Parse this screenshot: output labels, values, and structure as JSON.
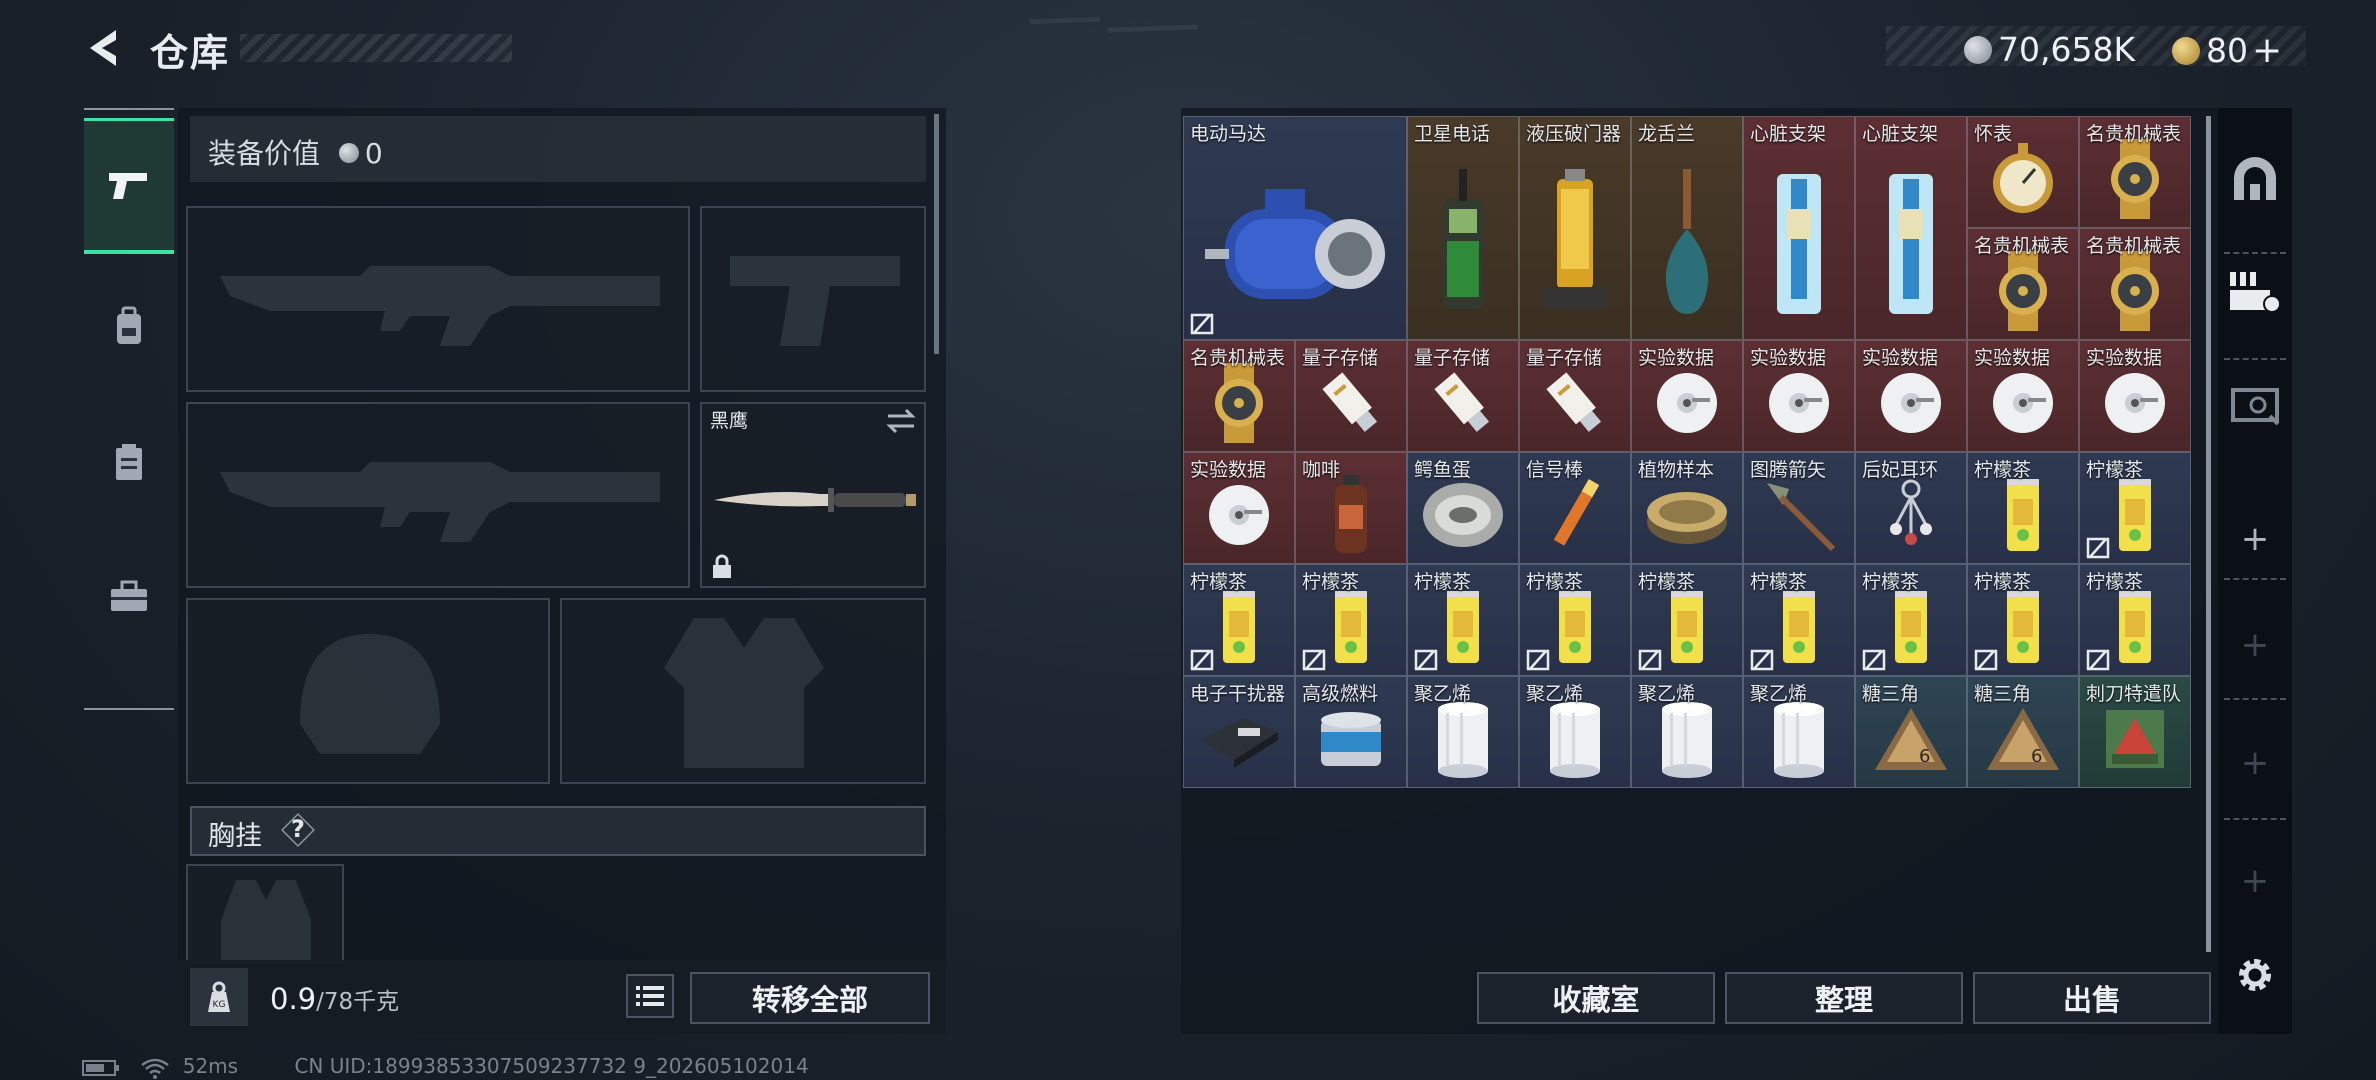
{
  "header": {
    "title": "仓库",
    "currency": [
      {
        "icon": "silver-coin-icon",
        "value": "70,658K"
      },
      {
        "icon": "gold-coin-icon",
        "value": "80"
      }
    ],
    "add_label": "+"
  },
  "left_nav": [
    {
      "icon": "pistol-icon",
      "active": true
    },
    {
      "icon": "backpack-icon",
      "active": false
    },
    {
      "icon": "clipboard-icon",
      "active": false
    },
    {
      "icon": "toolbox-icon",
      "active": false
    }
  ],
  "equipment": {
    "value_label": "装备价值",
    "value": "0",
    "melee_name": "黑鹰",
    "chest_label": "胸挂",
    "chest_help": "?",
    "weight_current": "0.9",
    "weight_max": "/78千克",
    "transfer_all": "转移全部"
  },
  "stash": {
    "items": [
      {
        "name": "电动马达",
        "icon": "motor-icon",
        "color": "blue",
        "col": 0,
        "row": 0,
        "w": 2,
        "h": 2,
        "nolock": true
      },
      {
        "name": "卫星电话",
        "icon": "sat-phone-icon",
        "color": "gold",
        "col": 2,
        "row": 0,
        "w": 1,
        "h": 2
      },
      {
        "name": "液压破门器",
        "icon": "hydraulic-breacher-icon",
        "color": "gold",
        "col": 3,
        "row": 0,
        "w": 1,
        "h": 2
      },
      {
        "name": "龙舌兰",
        "icon": "tequila-bottle-icon",
        "color": "gold",
        "col": 4,
        "row": 0,
        "w": 1,
        "h": 2
      },
      {
        "name": "心脏支架",
        "icon": "heart-stent-icon",
        "color": "red",
        "col": 5,
        "row": 0,
        "w": 1,
        "h": 2
      },
      {
        "name": "心脏支架",
        "icon": "heart-stent-icon",
        "color": "red",
        "col": 6,
        "row": 0,
        "w": 1,
        "h": 2
      },
      {
        "name": "怀表",
        "icon": "pocket-watch-icon",
        "color": "red",
        "col": 7,
        "row": 0,
        "w": 1,
        "h": 1
      },
      {
        "name": "名贵机械表",
        "icon": "gold-watch-icon",
        "color": "red",
        "col": 8,
        "row": 0,
        "w": 1,
        "h": 1
      },
      {
        "name": "名贵机械表",
        "icon": "gold-watch-icon",
        "color": "red",
        "col": 7,
        "row": 1,
        "w": 1,
        "h": 1
      },
      {
        "name": "名贵机械表",
        "icon": "gold-watch-icon",
        "color": "red",
        "col": 8,
        "row": 1,
        "w": 1,
        "h": 1
      },
      {
        "name": "名贵机械表",
        "icon": "gold-watch-icon",
        "color": "red",
        "col": 0,
        "row": 2,
        "w": 1,
        "h": 1
      },
      {
        "name": "量子存储",
        "icon": "usb-drive-icon",
        "color": "red",
        "col": 1,
        "row": 2,
        "w": 1,
        "h": 1
      },
      {
        "name": "量子存储",
        "icon": "usb-drive-icon",
        "color": "red",
        "col": 2,
        "row": 2,
        "w": 1,
        "h": 1
      },
      {
        "name": "量子存储",
        "icon": "usb-drive-icon",
        "color": "red",
        "col": 3,
        "row": 2,
        "w": 1,
        "h": 1
      },
      {
        "name": "实验数据",
        "icon": "data-disc-icon",
        "color": "red",
        "col": 4,
        "row": 2,
        "w": 1,
        "h": 1
      },
      {
        "name": "实验数据",
        "icon": "data-disc-icon",
        "color": "red",
        "col": 5,
        "row": 2,
        "w": 1,
        "h": 1
      },
      {
        "name": "实验数据",
        "icon": "data-disc-icon",
        "color": "red",
        "col": 6,
        "row": 2,
        "w": 1,
        "h": 1
      },
      {
        "name": "实验数据",
        "icon": "data-disc-icon",
        "color": "red",
        "col": 7,
        "row": 2,
        "w": 1,
        "h": 1
      },
      {
        "name": "实验数据",
        "icon": "data-disc-icon",
        "color": "red",
        "col": 8,
        "row": 2,
        "w": 1,
        "h": 1
      },
      {
        "name": "实验数据",
        "icon": "data-disc-icon",
        "color": "red",
        "col": 0,
        "row": 3,
        "w": 1,
        "h": 1
      },
      {
        "name": "咖啡",
        "icon": "coffee-bottle-icon",
        "color": "red",
        "col": 1,
        "row": 3,
        "w": 1,
        "h": 1
      },
      {
        "name": "鳄鱼蛋",
        "icon": "croc-egg-icon",
        "color": "blue",
        "col": 2,
        "row": 3,
        "w": 1,
        "h": 1
      },
      {
        "name": "信号棒",
        "icon": "flare-stick-icon",
        "color": "blue",
        "col": 3,
        "row": 3,
        "w": 1,
        "h": 1
      },
      {
        "name": "植物样本",
        "icon": "plant-sample-icon",
        "color": "blue",
        "col": 4,
        "row": 3,
        "w": 1,
        "h": 1
      },
      {
        "name": "图腾箭矢",
        "icon": "totem-arrow-icon",
        "color": "blue",
        "col": 5,
        "row": 3,
        "w": 1,
        "h": 1
      },
      {
        "name": "后妃耳环",
        "icon": "earring-icon",
        "color": "blue",
        "col": 6,
        "row": 3,
        "w": 1,
        "h": 1
      },
      {
        "name": "柠檬茶",
        "icon": "lemon-tea-can-icon",
        "color": "blue",
        "col": 7,
        "row": 3,
        "w": 1,
        "h": 1
      },
      {
        "name": "柠檬茶",
        "icon": "lemon-tea-can-icon",
        "color": "blue",
        "col": 8,
        "row": 3,
        "w": 1,
        "h": 1,
        "nolock": true
      },
      {
        "name": "柠檬茶",
        "icon": "lemon-tea-can-icon",
        "color": "blue",
        "col": 0,
        "row": 4,
        "w": 1,
        "h": 1,
        "nolock": true
      },
      {
        "name": "柠檬茶",
        "icon": "lemon-tea-can-icon",
        "color": "blue",
        "col": 1,
        "row": 4,
        "w": 1,
        "h": 1,
        "nolock": true
      },
      {
        "name": "柠檬茶",
        "icon": "lemon-tea-can-icon",
        "color": "blue",
        "col": 2,
        "row": 4,
        "w": 1,
        "h": 1,
        "nolock": true
      },
      {
        "name": "柠檬茶",
        "icon": "lemon-tea-can-icon",
        "color": "blue",
        "col": 3,
        "row": 4,
        "w": 1,
        "h": 1,
        "nolock": true
      },
      {
        "name": "柠檬茶",
        "icon": "lemon-tea-can-icon",
        "color": "blue",
        "col": 4,
        "row": 4,
        "w": 1,
        "h": 1,
        "nolock": true
      },
      {
        "name": "柠檬茶",
        "icon": "lemon-tea-can-icon",
        "color": "blue",
        "col": 5,
        "row": 4,
        "w": 1,
        "h": 1,
        "nolock": true
      },
      {
        "name": "柠檬茶",
        "icon": "lemon-tea-can-icon",
        "color": "blue",
        "col": 6,
        "row": 4,
        "w": 1,
        "h": 1,
        "nolock": true
      },
      {
        "name": "柠檬茶",
        "icon": "lemon-tea-can-icon",
        "color": "blue",
        "col": 7,
        "row": 4,
        "w": 1,
        "h": 1,
        "nolock": true
      },
      {
        "name": "柠檬茶",
        "icon": "lemon-tea-can-icon",
        "color": "blue",
        "col": 8,
        "row": 4,
        "w": 1,
        "h": 1,
        "nolock": true
      },
      {
        "name": "电子干扰器",
        "icon": "jammer-icon",
        "color": "blue",
        "col": 0,
        "row": 5,
        "w": 1,
        "h": 1
      },
      {
        "name": "高级燃料",
        "icon": "fuel-can-icon",
        "color": "blue",
        "col": 1,
        "row": 5,
        "w": 1,
        "h": 1
      },
      {
        "name": "聚乙烯",
        "icon": "polyethylene-roll-icon",
        "color": "blue",
        "col": 2,
        "row": 5,
        "w": 1,
        "h": 1
      },
      {
        "name": "聚乙烯",
        "icon": "polyethylene-roll-icon",
        "color": "blue",
        "col": 3,
        "row": 5,
        "w": 1,
        "h": 1
      },
      {
        "name": "聚乙烯",
        "icon": "polyethylene-roll-icon",
        "color": "blue",
        "col": 4,
        "row": 5,
        "w": 1,
        "h": 1
      },
      {
        "name": "聚乙烯",
        "icon": "polyethylene-roll-icon",
        "color": "blue",
        "col": 5,
        "row": 5,
        "w": 1,
        "h": 1
      },
      {
        "name": "糖三角",
        "icon": "sugar-triangle-icon",
        "color": "teal",
        "col": 6,
        "row": 5,
        "w": 1,
        "h": 1
      },
      {
        "name": "糖三角",
        "icon": "sugar-triangle-icon",
        "color": "teal",
        "col": 7,
        "row": 5,
        "w": 1,
        "h": 1
      },
      {
        "name": "刺刀特遣队",
        "icon": "bayonet-squad-card-icon",
        "color": "green",
        "col": 8,
        "row": 5,
        "w": 1,
        "h": 1
      }
    ],
    "buttons": {
      "collection": "收藏室",
      "sort": "整理",
      "sell": "出售"
    }
  },
  "right_nav": [
    {
      "icon": "safe-house-icon"
    },
    {
      "icon": "equipment-sort-icon"
    },
    {
      "icon": "stash-box-icon"
    },
    {
      "icon": "add-icon",
      "label": "+"
    },
    {
      "icon": "add-icon",
      "label": "+"
    },
    {
      "icon": "add-icon",
      "label": "+"
    },
    {
      "icon": "add-icon",
      "label": "+"
    },
    {
      "icon": "settings-gear-icon"
    }
  ],
  "status": {
    "ping": "52ms",
    "uid": "CN UID:18993853307509237732 9_202605102014"
  },
  "colors": {
    "accent_green": "#3fe0a6",
    "rarity_gold": "#4a3a29",
    "rarity_red": "#5c2f33",
    "rarity_blue": "#2f3a52"
  }
}
